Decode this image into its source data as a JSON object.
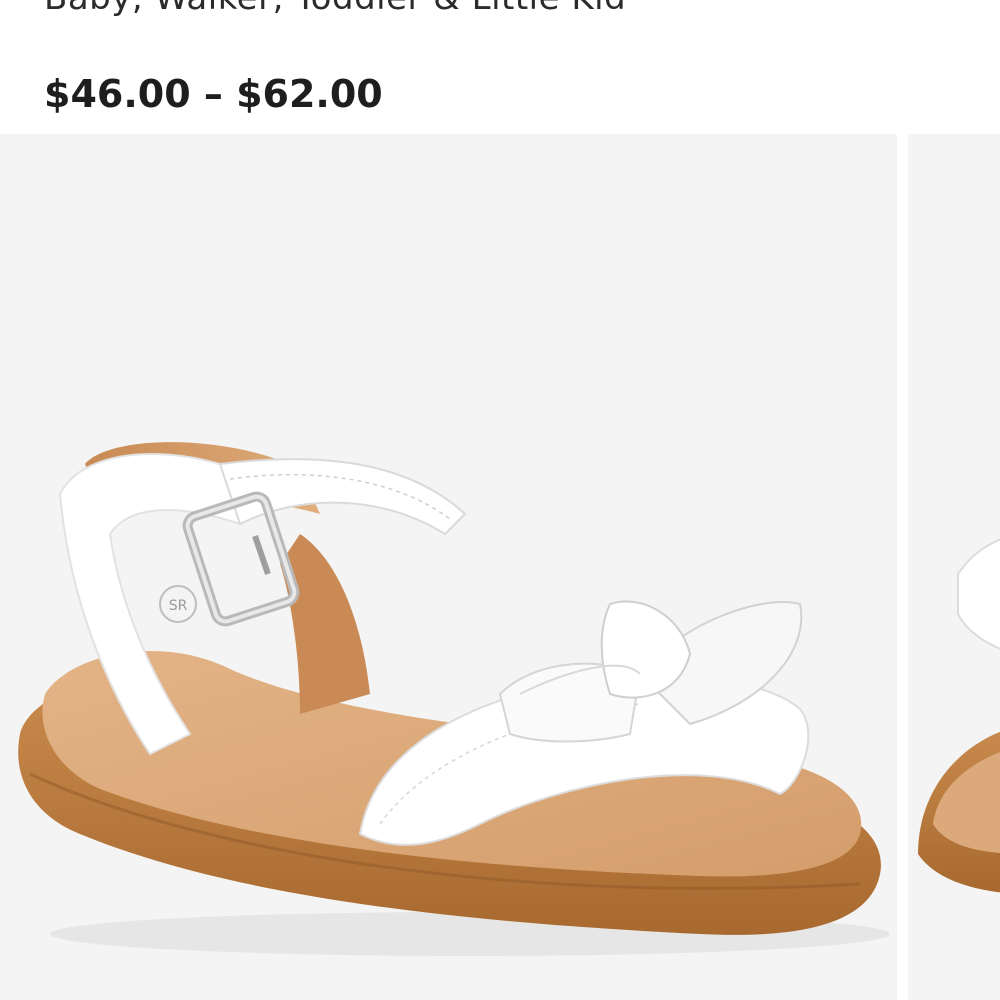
{
  "product": {
    "subtitle": "Baby, Walker, Toddler & Little Kid",
    "price_range": "$46.00 – $62.00"
  },
  "gallery": {
    "images": [
      {
        "name": "white leather sandal with bow",
        "icon": "sandal-image"
      },
      {
        "name": "next image (partial)",
        "icon": "sandal-image"
      }
    ],
    "brand_mark": "SR"
  },
  "colors": {
    "upper": "#ffffff",
    "sole": "#c9894a",
    "footbed": "#deaa7a",
    "background": "#f4f4f4"
  }
}
